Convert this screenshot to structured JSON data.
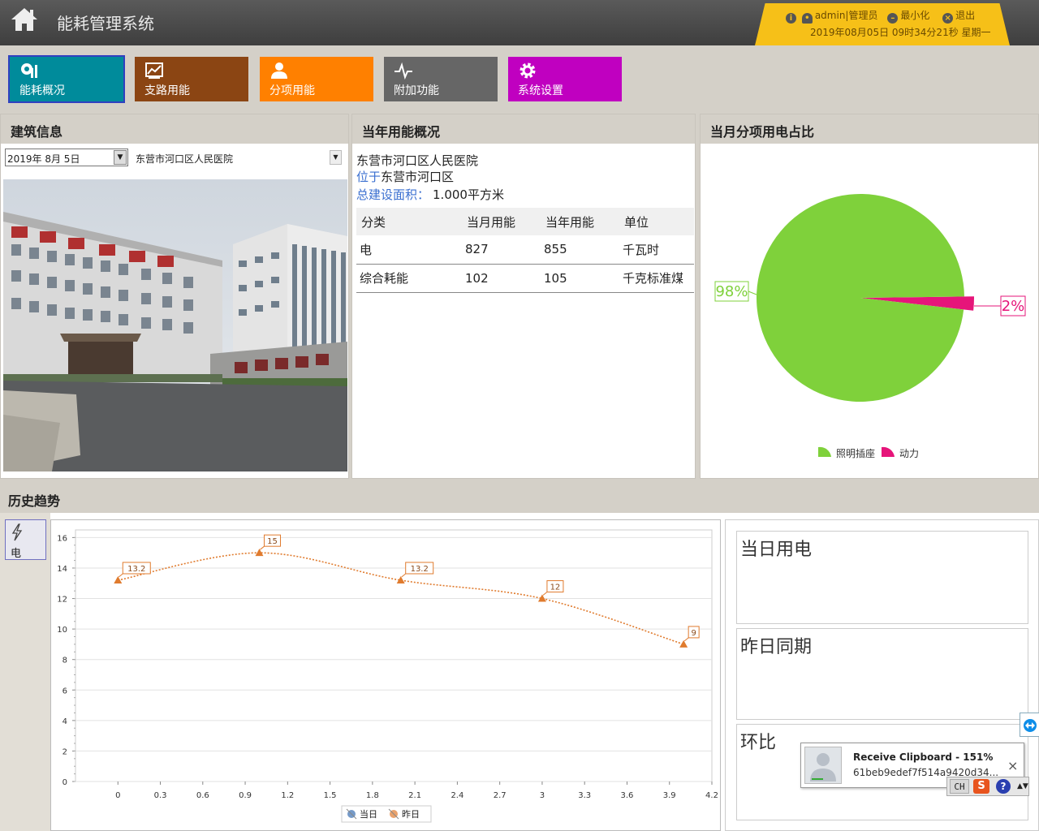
{
  "header": {
    "title": "能耗管理系统",
    "user": "admin|管理员",
    "minimize": "最小化",
    "logout": "退出",
    "datetime": "2019年08月05日 09时34分21秒 星期一"
  },
  "nav": [
    {
      "label": "能耗概况",
      "color": "#008b9b",
      "icon": "overview-icon"
    },
    {
      "label": "支路用能",
      "color": "#8b4513",
      "icon": "chart-icon"
    },
    {
      "label": "分项用能",
      "color": "#ff8000",
      "icon": "person-icon"
    },
    {
      "label": "附加功能",
      "color": "#666666",
      "icon": "pulse-icon"
    },
    {
      "label": "系统设置",
      "color": "#c000c0",
      "icon": "gear-icon"
    }
  ],
  "building": {
    "heading": "建筑信息",
    "date_value": "2019年  8月  5日",
    "location": "东营市河口区人民医院"
  },
  "yearly": {
    "heading": "当年用能概况",
    "name": "东营市河口区人民医院",
    "located_label": "位于",
    "located_value": "东营市河口区",
    "area_label": "总建设面积：",
    "area_value": "1.000平方米",
    "columns": [
      "分类",
      "当月用能",
      "当年用能",
      "单位"
    ],
    "rows": [
      [
        "电",
        "827",
        "855",
        "千瓦时"
      ],
      [
        "综合耗能",
        "102",
        "105",
        "千克标准煤"
      ]
    ]
  },
  "pie": {
    "heading": "当月分项用电占比",
    "chart_data": {
      "type": "pie",
      "slices": [
        {
          "name": "照明插座",
          "value": 98,
          "color": "#7fd13b",
          "label": "98%"
        },
        {
          "name": "动力",
          "value": 2,
          "color": "#e6157a",
          "label": "2%"
        }
      ]
    }
  },
  "history": {
    "heading": "历史趋势",
    "tab_label": "电",
    "chart_data": {
      "type": "line",
      "series": [
        {
          "name": "当日",
          "color": "#3a6fb0",
          "x": [],
          "y": []
        },
        {
          "name": "昨日",
          "color": "#e07b2e",
          "x": [
            0,
            1,
            2,
            3,
            4
          ],
          "y": [
            13.2,
            15,
            13.2,
            12,
            9
          ],
          "labels": [
            "13.2",
            "15",
            "13.2",
            "12",
            "9"
          ]
        }
      ],
      "xlim": [
        -0.3,
        4.2
      ],
      "ylim": [
        0,
        16.5
      ],
      "xticks": [
        "0",
        "0.3",
        "0.6",
        "0.9",
        "1.2",
        "1.5",
        "1.8",
        "2.1",
        "2.4",
        "2.7",
        "3",
        "3.3",
        "3.6",
        "3.9",
        "4.2"
      ],
      "yticks": [
        "0",
        "2",
        "4",
        "6",
        "8",
        "10",
        "12",
        "14",
        "16"
      ],
      "grid": true,
      "legend": "bottom"
    }
  },
  "stats": {
    "today": "当日用电",
    "yesterday": "昨日同期",
    "ratio": "环比"
  },
  "popup": {
    "title": "Receive Clipboard - 151%",
    "text": "61beb9edef7f514a9420d34...",
    "close": "×"
  },
  "tray": {
    "lang": "CH",
    "ime": "S",
    "help": "?"
  }
}
